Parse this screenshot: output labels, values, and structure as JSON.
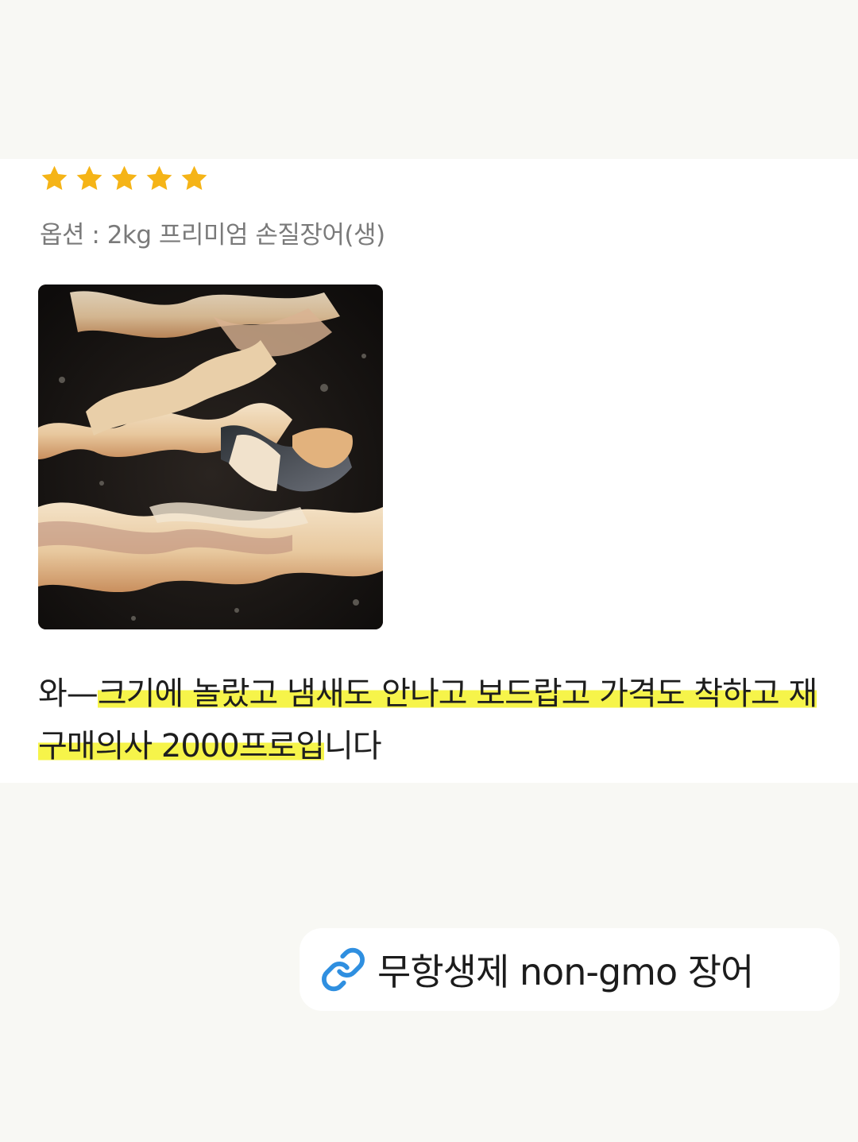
{
  "review": {
    "rating": 5,
    "rating_max": 5,
    "star_color": "#f5b417",
    "option_text": "옵션 : 2kg 프리미엄 손질장어(생)",
    "photo_icon": "grilled-eel-photo",
    "text_plain_start": "와—",
    "text_highlight": "크기에 놀랐고 냄새도 안나고 보드랍고 가격도 착하고 재구매의사 2000프로입",
    "text_plain_end": "니다",
    "highlight_color": "#f6f44a"
  },
  "link": {
    "icon": "link-icon",
    "icon_color": "#2f8fe0",
    "label": "무항생제 non-gmo 장어"
  }
}
